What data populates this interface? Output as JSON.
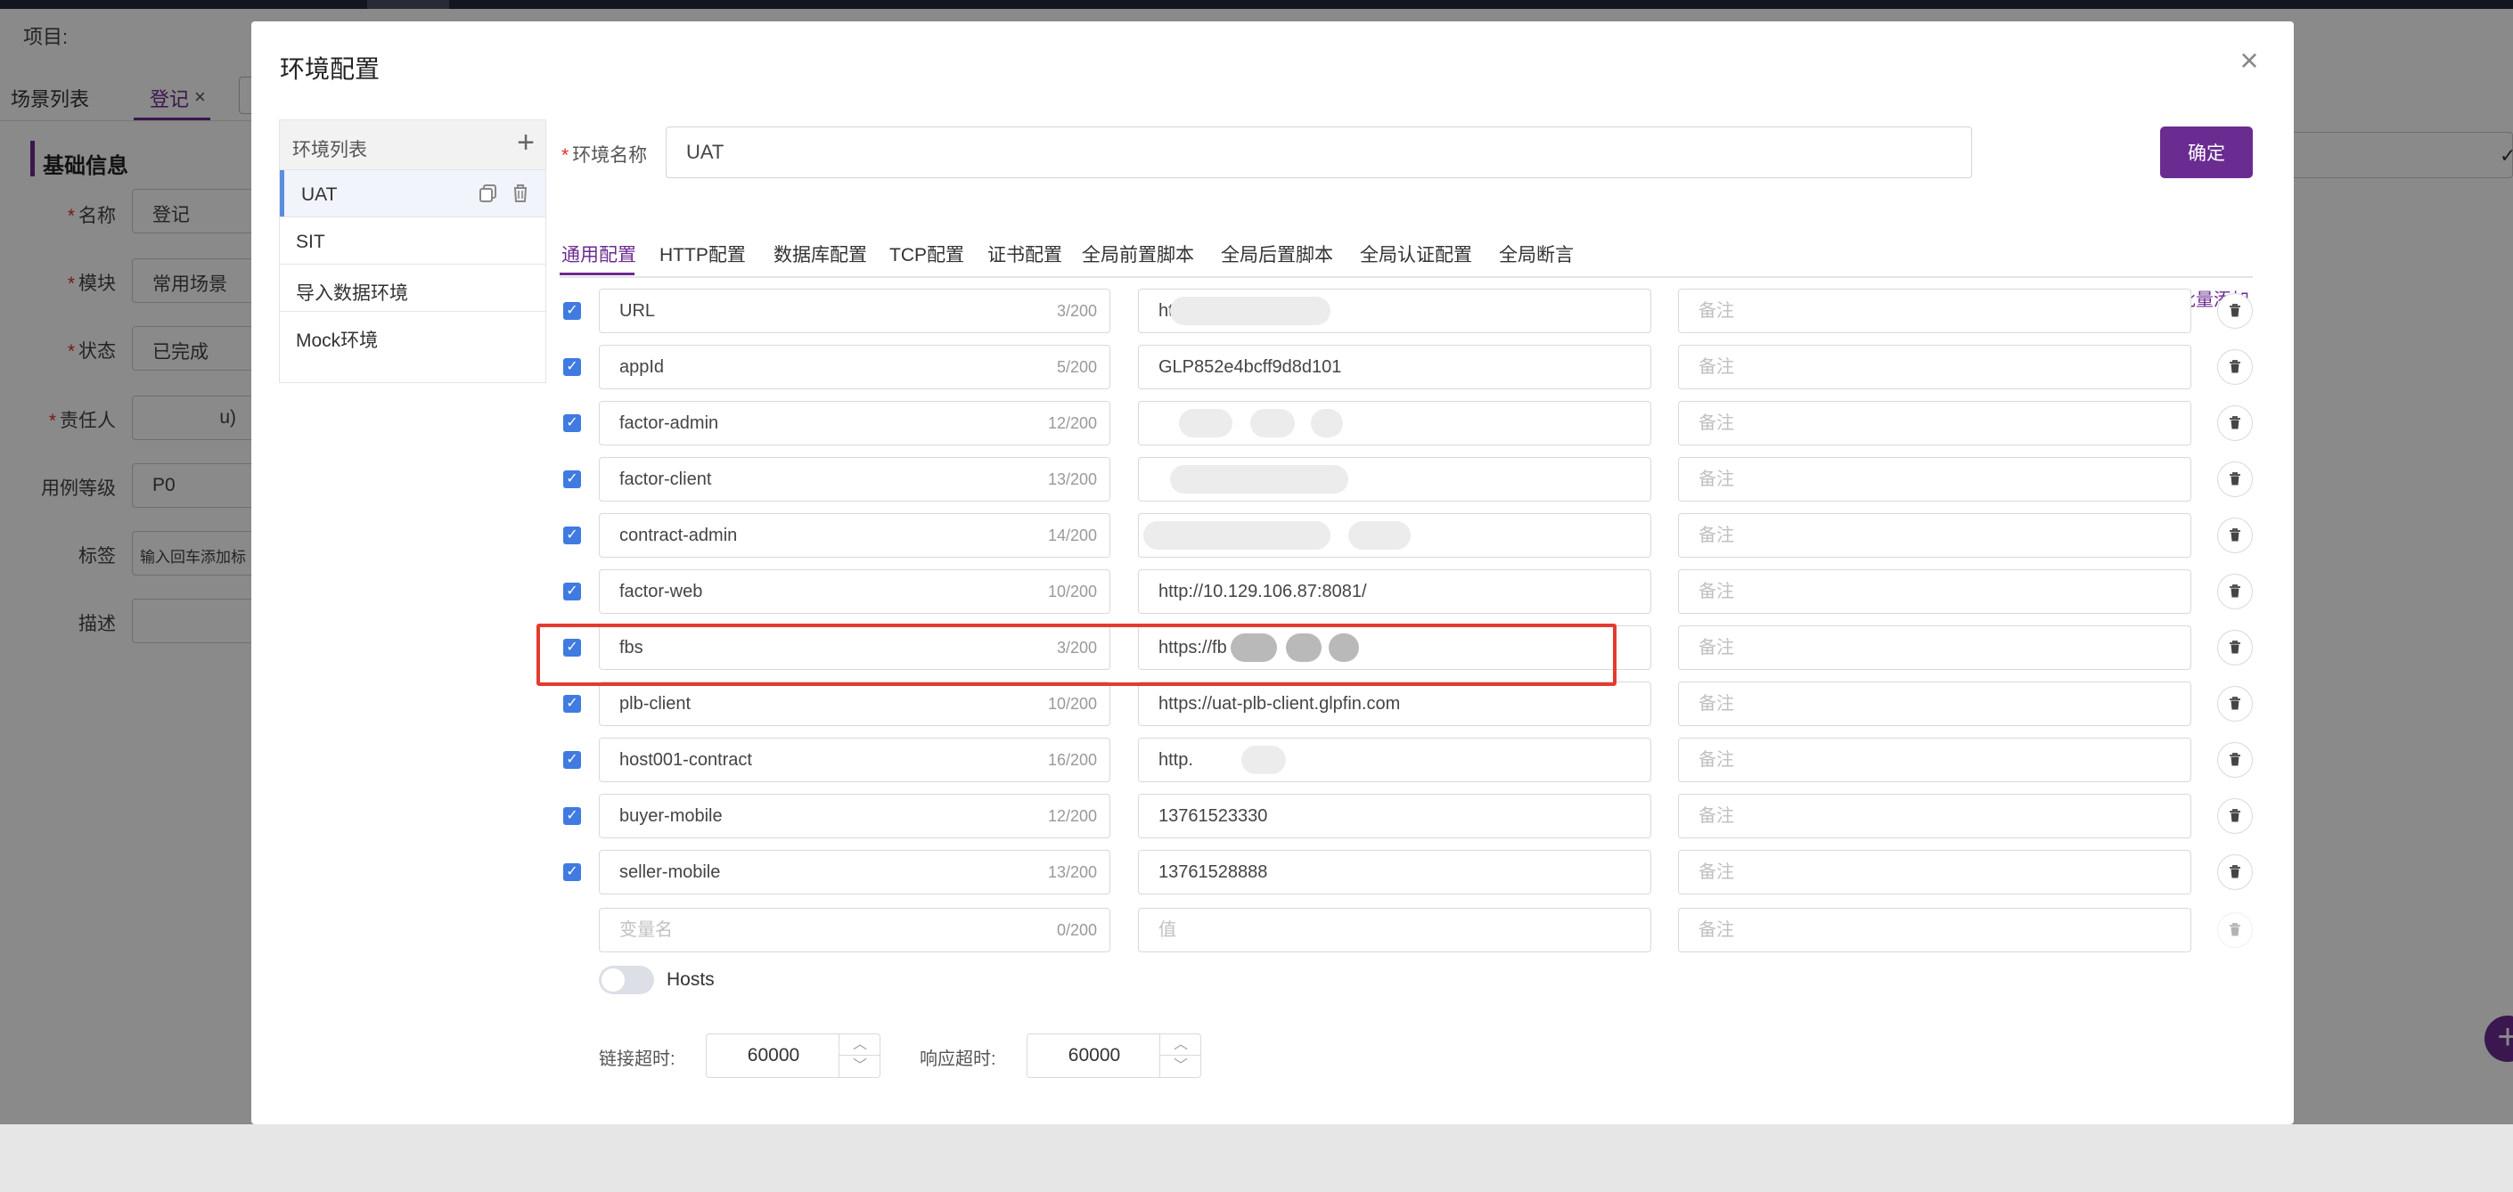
{
  "background_app": {
    "project_label": "项目:",
    "tabs": [
      "场景列表",
      "登记"
    ],
    "section_title": "基础信息",
    "form": [
      {
        "label": "名称",
        "required": true,
        "value": "登记"
      },
      {
        "label": "模块",
        "required": true,
        "value": "常用场景"
      },
      {
        "label": "状态",
        "required": true,
        "value": "已完成"
      },
      {
        "label": "责任人",
        "required": true,
        "value": "u)"
      },
      {
        "label": "用例等级",
        "required": false,
        "value": "P0"
      },
      {
        "label": "标签",
        "required": false,
        "value": "输入回车添加标"
      },
      {
        "label": "描述",
        "required": false,
        "value": ""
      }
    ]
  },
  "modal": {
    "title": "环境配置",
    "close_icon": "×",
    "env_list": {
      "header": "环境列表",
      "add_icon": "+",
      "items": [
        "UAT",
        "SIT",
        "导入数据环境",
        "Mock环境"
      ]
    },
    "name_label": "环境名称",
    "name_value": "UAT",
    "confirm_label": "确定",
    "tabs": [
      "通用配置",
      "HTTP配置",
      "数据库配置",
      "TCP配置",
      "证书配置",
      "全局前置脚本",
      "全局后置脚本",
      "全局认证配置",
      "全局断言"
    ],
    "active_tab": "通用配置",
    "batch_add_label": "批量添加",
    "note_placeholder": "备注",
    "variables": [
      {
        "checked": true,
        "name": "URL",
        "count": "3/200",
        "value": "https://uat-pt",
        "value_suffix": ".com"
      },
      {
        "checked": true,
        "name": "appId",
        "count": "5/200",
        "value": "GLP852e4bcff9d8d101",
        "value_suffix": ""
      },
      {
        "checked": true,
        "name": "factor-admin",
        "count": "12/200",
        "value": "",
        "value_suffix": ".com"
      },
      {
        "checked": true,
        "name": "factor-client",
        "count": "13/200",
        "value": "",
        "value_suffix": ".com"
      },
      {
        "checked": true,
        "name": "contract-admin",
        "count": "14/200",
        "value": "",
        "value_suffix": "com"
      },
      {
        "checked": true,
        "name": "factor-web",
        "count": "10/200",
        "value": "http://10.129.106.87:8081/",
        "value_suffix": ""
      },
      {
        "checked": true,
        "name": "fbs",
        "count": "3/200",
        "value": "https://fb",
        "value_suffix": "in.com"
      },
      {
        "checked": true,
        "name": "plb-client",
        "count": "10/200",
        "value": "https://uat-plb-client.glpfin.com",
        "value_suffix": ""
      },
      {
        "checked": true,
        "name": "host001-contract",
        "count": "16/200",
        "value": "http.",
        "value_suffix": "168-inner.com:8086"
      },
      {
        "checked": true,
        "name": "buyer-mobile",
        "count": "12/200",
        "value": "13761523330",
        "value_suffix": ""
      },
      {
        "checked": true,
        "name": "seller-mobile",
        "count": "13/200",
        "value": "13761528888",
        "value_suffix": ""
      }
    ],
    "new_row": {
      "name_placeholder": "变量名",
      "count": "0/200",
      "value_placeholder": "值"
    },
    "hosts_label": "Hosts",
    "hosts_enabled": false,
    "connect_timeout_label": "链接超时:",
    "connect_timeout_value": "60000",
    "response_timeout_label": "响应超时:",
    "response_timeout_value": "60000",
    "highlighted_variable": "fbs",
    "colors": {
      "accent": "#6b2c91",
      "checkbox": "#3f7be0",
      "highlight": "#e53a2f"
    },
    "icons": [
      "close-icon",
      "plus-icon",
      "copy-icon",
      "trash-icon",
      "check-icon",
      "chevron-up-icon",
      "chevron-down-icon"
    ]
  }
}
